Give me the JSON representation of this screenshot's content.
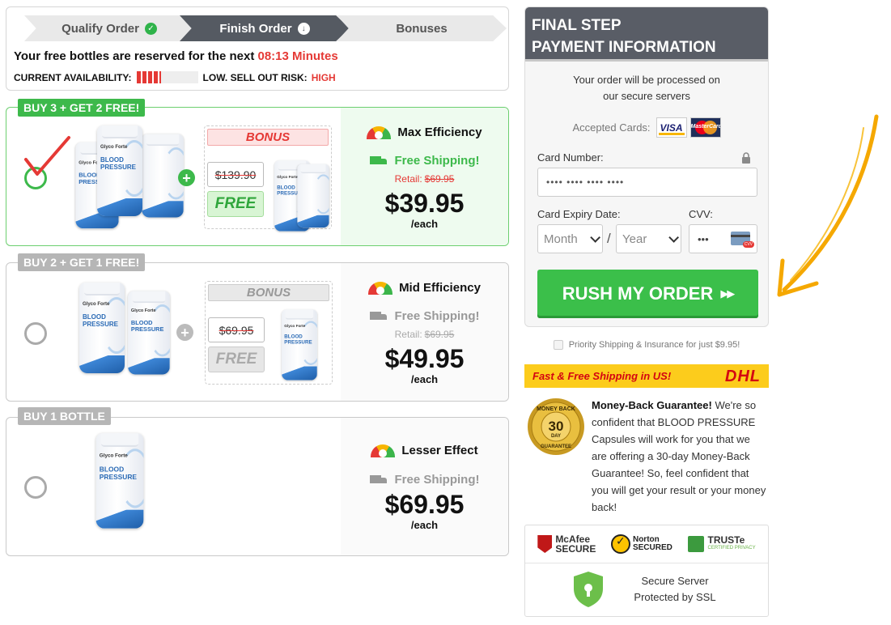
{
  "steps": [
    {
      "label": "Qualify Order",
      "icon": "check-circle-icon"
    },
    {
      "label": "Finish Order",
      "icon": "arrow-down-circle-icon"
    },
    {
      "label": "Bonuses"
    }
  ],
  "reservation": {
    "text": "Your free bottles are reserved for the next",
    "timer": "08:13 Minutes"
  },
  "availability": {
    "label": "CURRENT AVAILABILITY:",
    "level": "LOW.",
    "risk_label": "SELL OUT RISK:",
    "risk_value": "HIGH"
  },
  "offers": [
    {
      "tag": "BUY 3 + GET 2 FREE!",
      "selected": true,
      "bonus_label": "BONUS",
      "bonus_old_price": "$139.90",
      "bonus_free": "FREE",
      "efficiency": "Max Efficiency",
      "shipping": "Free Shipping!",
      "retail_label": "Retail:",
      "retail_price": "$69.95",
      "price": "$39.95",
      "per": "/each"
    },
    {
      "tag": "BUY 2 + GET 1 FREE!",
      "selected": false,
      "bonus_label": "BONUS",
      "bonus_old_price": "$69.95",
      "bonus_free": "FREE",
      "efficiency": "Mid Efficiency",
      "shipping": "Free Shipping!",
      "retail_label": "Retail:",
      "retail_price": "$69.95",
      "price": "$49.95",
      "per": "/each"
    },
    {
      "tag": "BUY 1 BOTTLE",
      "selected": false,
      "efficiency": "Lesser Effect",
      "shipping": "Free Shipping!",
      "price": "$69.95",
      "per": "/each"
    }
  ],
  "bottle": {
    "brand": "Glyco Forte",
    "product_line1": "BLOOD",
    "product_line2": "PRESSURE"
  },
  "payment": {
    "title_line1": "FINAL STEP",
    "title_line2": "PAYMENT INFORMATION",
    "processed_line1": "Your order will be processed on",
    "processed_line2": "our secure servers",
    "accepted_label": "Accepted Cards:",
    "visa": "VISA",
    "mastercard": "MasterCard",
    "card_number_label": "Card Number:",
    "card_number_value": "•••• •••• •••• ••••",
    "expiry_label": "Card Expiry Date:",
    "month_placeholder": "Month",
    "year_placeholder": "Year",
    "separator": "/",
    "cvv_label": "CVV:",
    "cvv_value": "•••",
    "cvv_badge": "CVV",
    "submit_label": "RUSH MY ORDER"
  },
  "priority_shipping": "Priority Shipping & Insurance for just $9.95!",
  "dhl": {
    "text": "Fast & Free Shipping in US!",
    "logo": "DHL"
  },
  "guarantee": {
    "seal_top": "MONEY BACK",
    "seal_num": "30",
    "seal_day": "DAY",
    "seal_bottom": "GUARANTEE",
    "title": "Money-Back Guarantee!",
    "body": "We're so confident that BLOOD PRESSURE Capsules will work for you that we are offering a 30-day Money-Back Guarantee! So, feel confident that you will get your result or your money back!"
  },
  "trust": {
    "mcafee_1": "McAfee",
    "mcafee_2": "SECURE",
    "norton_1": "Norton",
    "norton_2": "SECURED",
    "truste_1": "TRUSTe",
    "truste_2": "CERTIFIED PRIVACY",
    "ssl_line1": "Secure Server",
    "ssl_line2": "Protected by SSL"
  },
  "colors": {
    "green": "#3db94b",
    "red": "#e53935",
    "dark": "#595d66",
    "dhl_yellow": "#fccc1c",
    "arrow": "#f5a800"
  }
}
